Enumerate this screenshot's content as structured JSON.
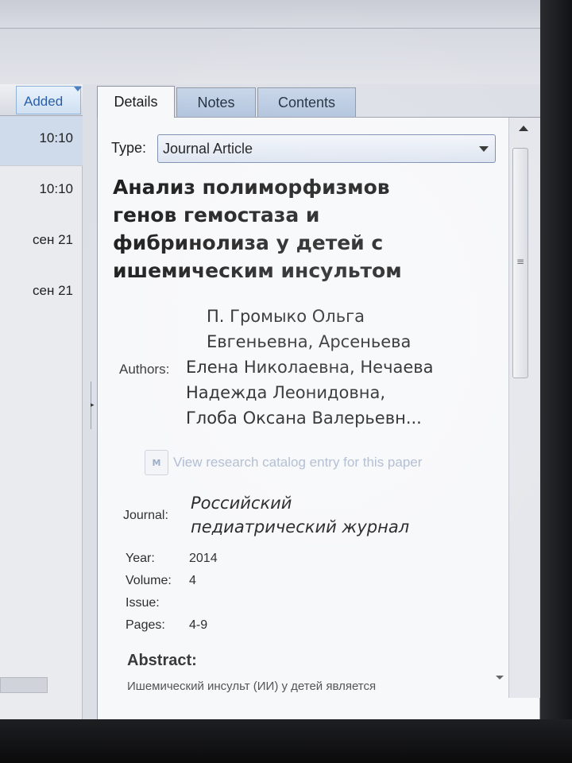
{
  "list": {
    "column_header": "Added",
    "rows": [
      {
        "time": "10:10"
      },
      {
        "time": "10:10"
      },
      {
        "time": "сен 21"
      },
      {
        "time": "сен 21"
      }
    ]
  },
  "tabs": [
    {
      "label": "Details",
      "active": true
    },
    {
      "label": "Notes",
      "active": false
    },
    {
      "label": "Contents",
      "active": false
    }
  ],
  "details": {
    "type_label": "Type:",
    "type_value": "Journal Article",
    "title_lines": [
      "Анализ полиморфизмов",
      "генов гемостаза и",
      "фибринолиза у детей с",
      "ишемическим инсультом"
    ],
    "authors_label": "Authors:",
    "authors_lines": [
      "П. Громыко Ольга",
      "Евгеньевна, Арсеньева",
      "Елена Николаевна, Нечаева",
      "Надежда Леонидовна,",
      "Глоба Оксана Валерьевн..."
    ],
    "catalog_link": "View research catalog entry for this paper",
    "journal_label": "Journal:",
    "journal_lines": [
      "Российский",
      "педиатрический журнал"
    ],
    "year_label": "Year:",
    "year_value": "2014",
    "volume_label": "Volume:",
    "volume_value": "4",
    "issue_label": "Issue:",
    "issue_value": "",
    "pages_label": "Pages:",
    "pages_value": "4-9",
    "abstract_heading": "Abstract:",
    "abstract_text": "Ишемический инсульт (ИИ) у детей является"
  },
  "icons": {
    "sort": "sort-descending-icon",
    "dropdown": "chevron-down-icon",
    "scroll_up": "scroll-up-arrow-icon",
    "catalog": "research-catalog-icon"
  },
  "colors": {
    "tab_inactive": "#aec2dc",
    "link": "#6f86ad",
    "selection": "#cfdbeb"
  }
}
